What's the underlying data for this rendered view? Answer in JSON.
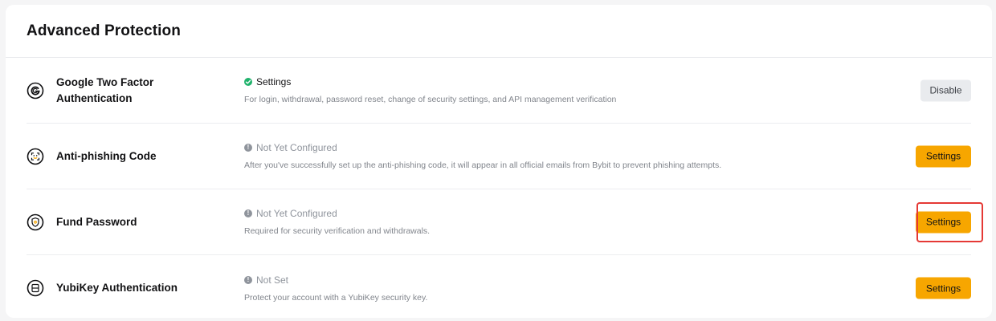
{
  "section": {
    "title": "Advanced Protection"
  },
  "rows": [
    {
      "icon": "google-authenticator-icon",
      "name_line1": "Google Two Factor",
      "name_line2": "Authentication",
      "status": "Settings",
      "status_type": "ok",
      "description": "For login, withdrawal, password reset, change of security settings, and API management verification",
      "button": "Disable"
    },
    {
      "icon": "anti-phishing-face-icon",
      "name_line1": "Anti-phishing Code",
      "name_line2": "",
      "status": "Not Yet Configured",
      "status_type": "warn",
      "description": "After you've successfully set up the anti-phishing code, it will appear in all official emails from Bybit to prevent phishing attempts.",
      "button": "Settings"
    },
    {
      "icon": "fund-password-shield-icon",
      "name_line1": "Fund Password",
      "name_line2": "",
      "status": "Not Yet Configured",
      "status_type": "warn",
      "description": "Required for security verification and withdrawals.",
      "button": "Settings",
      "highlighted": true
    },
    {
      "icon": "yubikey-icon",
      "name_line1": "YubiKey Authentication",
      "name_line2": "",
      "status": "Not Set",
      "status_type": "warn",
      "description": "Protect your account with a YubiKey security key.",
      "button": "Settings"
    }
  ],
  "colors": {
    "accent": "#f7a600",
    "success": "#20b26c",
    "muted": "#8f949c",
    "highlight": "#e53935"
  }
}
